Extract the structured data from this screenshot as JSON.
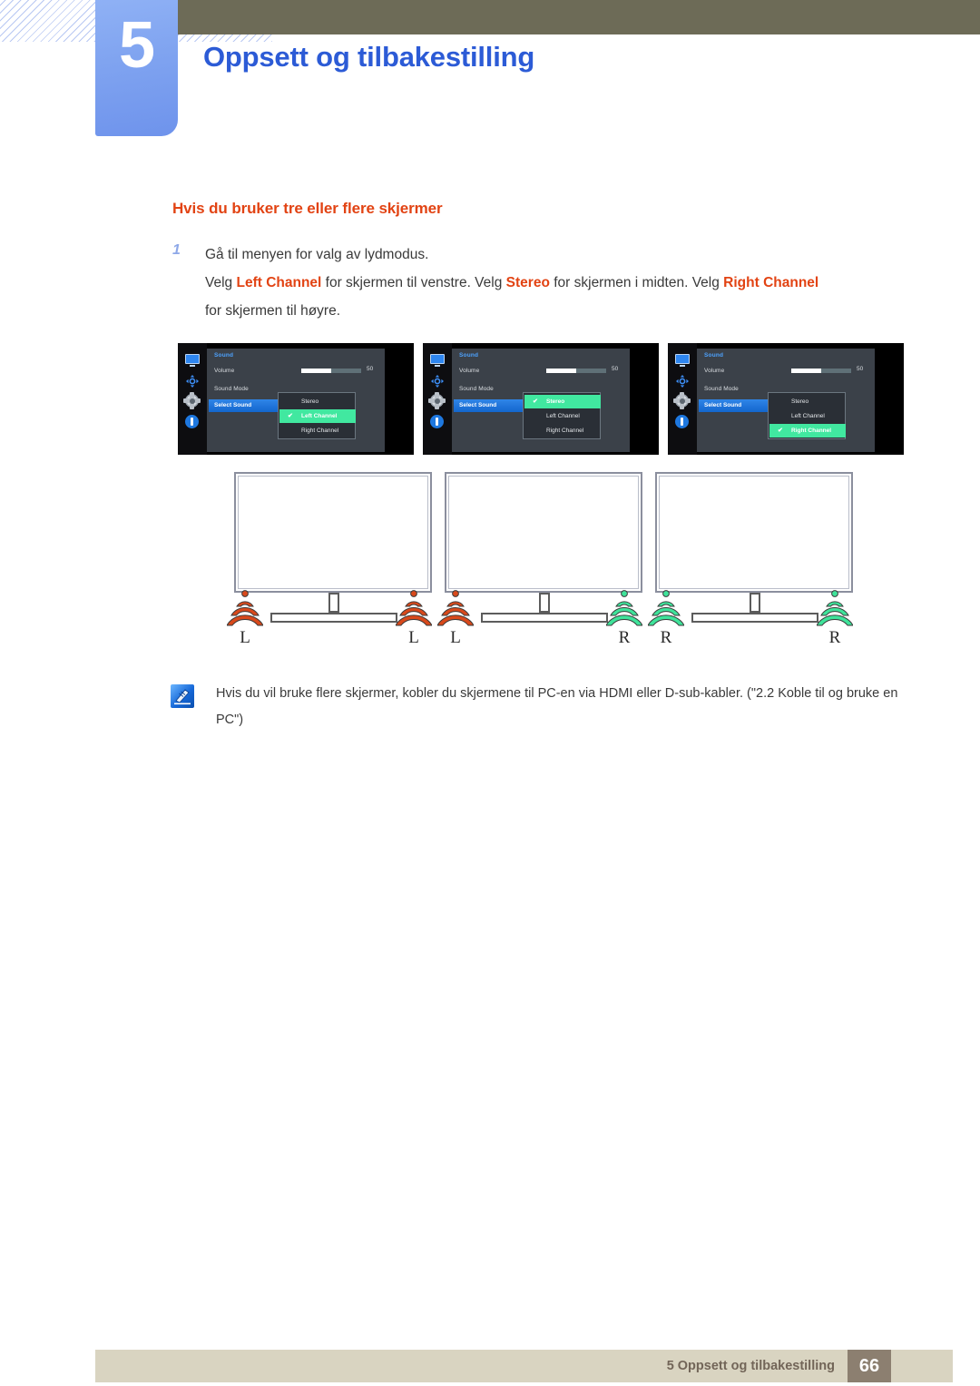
{
  "header": {
    "chapter_number": "5",
    "chapter_title": "Oppsett og tilbakestilling"
  },
  "content": {
    "subheading": "Hvis du bruker tre eller flere skjermer",
    "step_number": "1",
    "step_line1": "Gå til menyen for valg av lydmodus.",
    "step_line2_a": "Velg ",
    "step_line2_b": "Left Channel",
    "step_line2_c": " for skjermen til venstre. Velg ",
    "step_line2_d": "Stereo",
    "step_line2_e": " for skjermen i midten. Velg ",
    "step_line2_f": "Right Channel",
    "step_line3": "for skjermen til høyre."
  },
  "osd_menus": [
    {
      "title": "Sound",
      "items": [
        "Volume",
        "Sound Mode"
      ],
      "selected_item": "Select Sound",
      "volume_value": "50",
      "volume_percent": 50,
      "options": [
        "Stereo",
        "Left Channel",
        "Right Channel"
      ],
      "checked_option": "Left Channel",
      "checked_index": 1,
      "check_glyph": "✔"
    },
    {
      "title": "Sound",
      "items": [
        "Volume",
        "Sound Mode"
      ],
      "selected_item": "Select Sound",
      "volume_value": "50",
      "volume_percent": 50,
      "options": [
        "Stereo",
        "Left Channel",
        "Right Channel"
      ],
      "checked_option": "Stereo",
      "checked_index": 0,
      "check_glyph": "✔"
    },
    {
      "title": "Sound",
      "items": [
        "Volume",
        "Sound Mode"
      ],
      "selected_item": "Select Sound",
      "volume_value": "50",
      "volume_percent": 50,
      "options": [
        "Stereo",
        "Left Channel",
        "Right Channel"
      ],
      "checked_option": "Right Channel",
      "checked_index": 2,
      "check_glyph": "✔"
    }
  ],
  "diagram": {
    "monitor_count": 3,
    "speakers": [
      {
        "label": "L",
        "color": "#d8491b"
      },
      {
        "label": "L",
        "color": "#d8491b"
      },
      {
        "label": "L",
        "color": "#d8491b"
      },
      {
        "label": "R",
        "color": "#3fe39a"
      },
      {
        "label": "R",
        "color": "#3fe39a"
      },
      {
        "label": "R",
        "color": "#3fe39a"
      }
    ]
  },
  "note": {
    "icon": "note-pen-icon",
    "text": "Hvis du vil bruke flere skjermer, kobler du skjermene til PC-en via HDMI eller D-sub-kabler. (\"2.2 Koble til og bruke en PC\")"
  },
  "footer": {
    "text": "5 Oppsett og tilbakestilling",
    "page_number": "66"
  },
  "colors": {
    "topbar": "#6d6b57",
    "chapter_blue": "#2c5bd6",
    "accent_orange": "#e24313",
    "footer_bar": "#d9d4c1",
    "footer_page_box": "#8c7f70",
    "osd_highlight": "#41e8a0",
    "osd_selection": "#2f85e8"
  }
}
